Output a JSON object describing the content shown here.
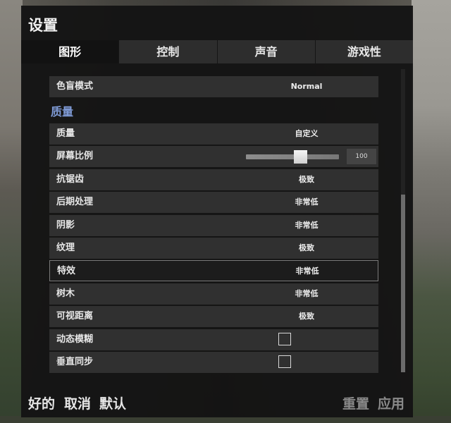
{
  "window": {
    "title": "设置"
  },
  "tabs": [
    {
      "label": "图形",
      "active": true
    },
    {
      "label": "控制",
      "active": false
    },
    {
      "label": "声音",
      "active": false
    },
    {
      "label": "游戏性",
      "active": false
    }
  ],
  "colorblind": {
    "label": "色盲模式",
    "value": "Normal"
  },
  "section": {
    "title": "质量"
  },
  "settings": [
    {
      "label": "质量",
      "value": "自定义"
    },
    {
      "label": "屏幕比例",
      "slider_value": "100",
      "slider_fraction": 0.59
    },
    {
      "label": "抗锯齿",
      "value": "极致"
    },
    {
      "label": "后期处理",
      "value": "非常低"
    },
    {
      "label": "阴影",
      "value": "非常低"
    },
    {
      "label": "纹理",
      "value": "极致"
    },
    {
      "label": "特效",
      "value": "非常低",
      "highlighted": true
    },
    {
      "label": "树木",
      "value": "非常低"
    },
    {
      "label": "可视距离",
      "value": "极致"
    },
    {
      "label": "动态模糊",
      "checked": false
    },
    {
      "label": "垂直同步",
      "checked": false
    }
  ],
  "footer": {
    "ok": "好的",
    "cancel": "取消",
    "default": "默认",
    "reset": "重置",
    "apply": "应用"
  },
  "colors": {
    "section_title": "#7f9bd6",
    "panel_bg": "#141414",
    "row_bg": "#303030",
    "active_tab_bg": "#121212",
    "disabled_text": "#8a8a8a"
  }
}
